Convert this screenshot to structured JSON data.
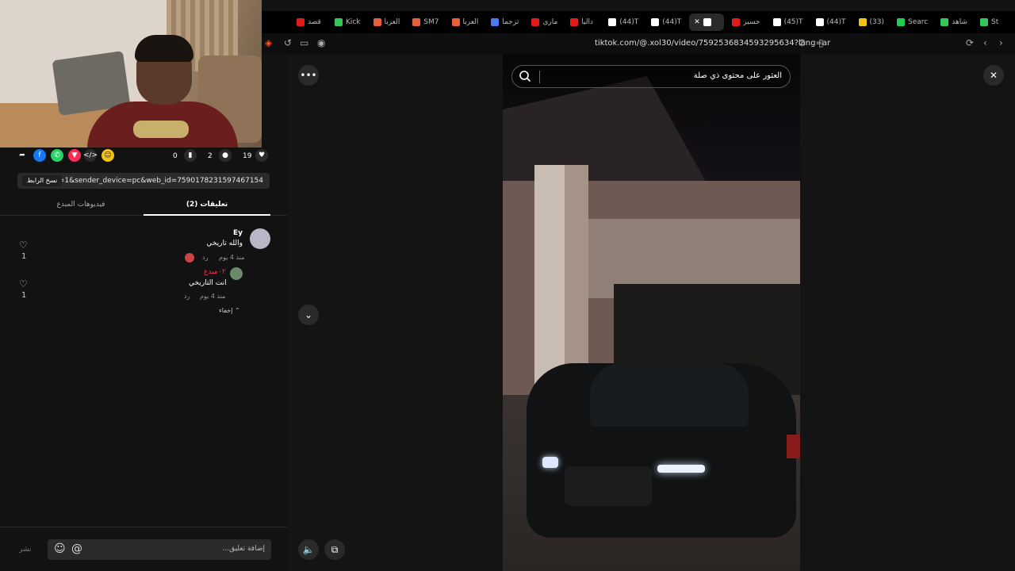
{
  "browser": {
    "tabs": [
      {
        "label": "St",
        "color": "#35c759"
      },
      {
        "label": "شاهد",
        "color": "#35c759"
      },
      {
        "label": "Searc",
        "color": "#1fcf4f"
      },
      {
        "label": "(33)",
        "color": "#f1c40f"
      },
      {
        "label": "(44)T",
        "color": "#ffffff"
      },
      {
        "label": "(45)T",
        "color": "#ffffff"
      },
      {
        "label": "حسير",
        "color": "#e31b1b"
      },
      {
        "label": "",
        "color": "#ffffff",
        "active": true
      },
      {
        "label": "(44)T",
        "color": "#ffffff"
      },
      {
        "label": "(44)T",
        "color": "#ffffff"
      },
      {
        "label": "داليا",
        "color": "#e31b1b"
      },
      {
        "label": "ماري",
        "color": "#e31b1b"
      },
      {
        "label": "ترجما",
        "color": "#4a7cf0"
      },
      {
        "label": "العربا",
        "color": "#e85f3a"
      },
      {
        "label": "SM7",
        "color": "#e85f3a"
      },
      {
        "label": "العربا",
        "color": "#e85f3a"
      },
      {
        "label": "Kick",
        "color": "#35c759"
      },
      {
        "label": "قصد",
        "color": "#e31b1b"
      }
    ],
    "url": "tiktok.com/@.xol30/video/7592536834593295634?lang=ar"
  },
  "actions": {
    "likes": "19",
    "comments": "2",
    "saves": "0"
  },
  "share": {
    "link": "...pp=1&sender_device=pc&web_id=7590178231597467154",
    "copy_label": "نسخ الرابط"
  },
  "tabs": {
    "comments": "تعليقات (2)",
    "creator_videos": "فيديوهات المبدع"
  },
  "comments": [
    {
      "user": "Ey",
      "text": "والله تاريخي",
      "time": "منذ 4 يوم",
      "reply": "رد",
      "likes": "1"
    },
    {
      "user": "مبدع",
      "prefix": "٠٢",
      "text": "انت التاريخي",
      "time": "منذ 4 يوم",
      "reply": "رد",
      "likes": "1"
    }
  ],
  "hide_label": "إخفاء",
  "composer": {
    "placeholder": "إضافة تعليق...",
    "post": "نشر"
  },
  "video": {
    "search_placeholder": "العثور على محتوى ذي صلة"
  }
}
